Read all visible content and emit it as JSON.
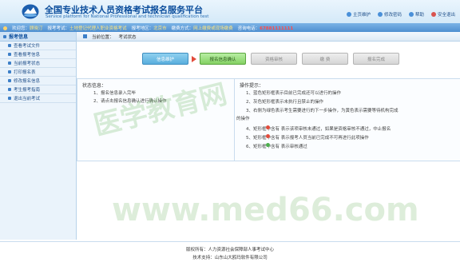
{
  "header": {
    "title_cn": "全国专业技术人员资格考试报名服务平台",
    "title_en": "Service platform for National Professional and technician qualification test",
    "links": [
      "主页维护",
      "修改密码",
      "帮助",
      "安全退出"
    ]
  },
  "infobar": {
    "welcome_label": "欢迎您：",
    "welcome_name": "顾晓汀",
    "exam_label": "报考考试：",
    "exam_value": "土地登记代理人职业资格考试",
    "region_label": "报考地区：",
    "region_value": "北京市",
    "fee_label": "缴费方式：",
    "fee_value": "网上缴费或现场缴费",
    "phone_label": "咨询电话：",
    "phone_value": "67881111111"
  },
  "sidebar": {
    "heading": "报考信息",
    "items": [
      "查看考试文件",
      "查看报考信息",
      "当前报考状态",
      "打印报名表",
      "修改报名信息",
      "考生报考指南",
      "退出当前考试"
    ]
  },
  "breadcrumb": {
    "label": "当前位置：",
    "current": "考试状态"
  },
  "steps": [
    "信息维护",
    "报名信息确认",
    "资格审核",
    "缴 费",
    "报名完成"
  ],
  "status": {
    "title": "状态信息：",
    "lines": [
      "1、报名信息录入完毕",
      "2、请点击报名信息确认进行确认操作"
    ]
  },
  "tips": {
    "title": "操作提示：",
    "lines": [
      "1、蓝色矩形框表示目前已完成还可以进行的操作",
      "2、灰色矩形框表示未执行且禁止的操作",
      "3、右侧为绿色表示考生需要进行的下一步操作，为黄色表示需要等待机构完成",
      "的操作",
      "4、矩形框中含有 表示该项审核未通过，如果是资格审核不通过，中止报名",
      "5、矩形框中含有 表示报考人员当前已完成不可再进行此项操作",
      "6、矩形框中含有 表示审核通过"
    ]
  },
  "footer": {
    "copyright": "版权所有：人力资源社会保障部人事考试中心",
    "support": "技术支持：山东山大鸥玛软件有限公司"
  },
  "watermark": {
    "text1": "医学教育网",
    "text2": "www.med66.com"
  },
  "colors": {
    "header_blue": "#0b4d9c",
    "step_blue": "#5aaedd",
    "step_green": "#84d163",
    "arrow_red": "#e24b3b",
    "phone_red": "#ff4a4a"
  }
}
